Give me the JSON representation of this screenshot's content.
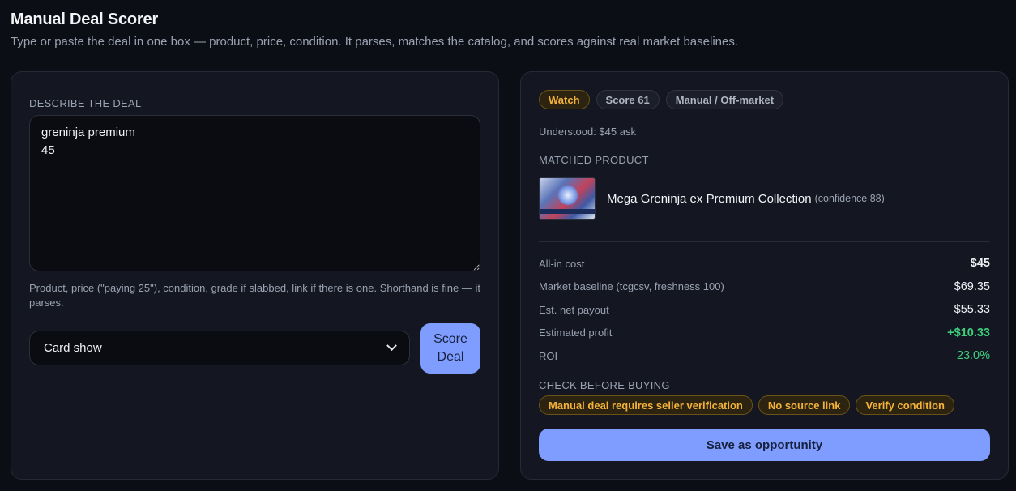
{
  "header": {
    "title": "Manual Deal Scorer",
    "subtitle": "Type or paste the deal in one box — product, price, condition. It parses, matches the catalog, and scores against real market baselines."
  },
  "input_panel": {
    "describe_label": "DESCRIBE THE DEAL",
    "deal_text": "greninja premium\n45",
    "help_text": "Product, price (\"paying 25\"), condition, grade if slabbed, link if there is one. Shorthand is fine — it parses.",
    "source_select": {
      "selected": "Card show"
    },
    "score_button_label": "Score Deal"
  },
  "result_panel": {
    "badges": [
      "Watch",
      "Score 61",
      "Manual / Off-market"
    ],
    "understood": "Understood: $45 ask",
    "matched_label": "MATCHED PRODUCT",
    "product": {
      "name": "Mega Greninja ex Premium Collection",
      "confidence": "(confidence 88)"
    },
    "metrics": [
      {
        "label": "All-in cost",
        "value": "$45"
      },
      {
        "label": "Market baseline (tcgcsv, freshness 100)",
        "value": "$69.35"
      },
      {
        "label": "Est. net payout",
        "value": "$55.33"
      },
      {
        "label": "Estimated profit",
        "value": "+$10.33"
      },
      {
        "label": "ROI",
        "value": "23.0%"
      }
    ],
    "check_label": "CHECK BEFORE BUYING",
    "warnings": [
      "Manual deal requires seller verification",
      "No source link",
      "Verify condition"
    ],
    "save_button_label": "Save as opportunity"
  },
  "colors": {
    "background": "#0c0e15",
    "panel": "#141721",
    "accent": "#7f9cff",
    "warning": "#f4b23a",
    "positive": "#3ecf7e"
  }
}
